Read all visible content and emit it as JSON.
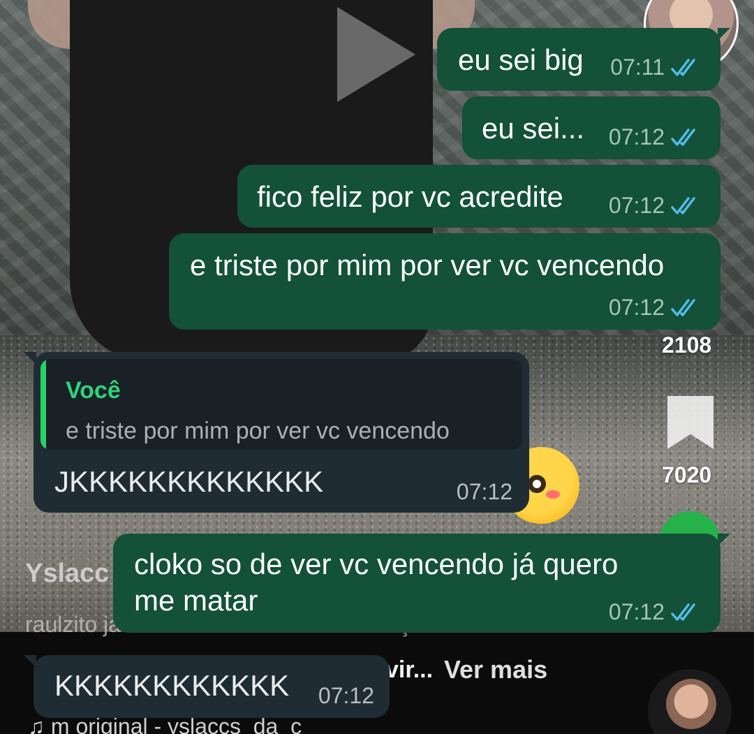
{
  "chat": {
    "messages": [
      {
        "text": "eu sei big",
        "time": "07:11",
        "status": "read"
      },
      {
        "text": "eu sei...",
        "time": "07:12",
        "status": "read"
      },
      {
        "text": "fico feliz por vc acredite",
        "time": "07:12",
        "status": "read"
      },
      {
        "text": "e triste por mim por ver vc vencendo",
        "time": "07:12",
        "status": "read"
      },
      {
        "quote_author": "Você",
        "quote_text": "e triste por mim por ver vc vencendo",
        "text": "JKKKKKKKKKKKKK",
        "time": "07:12"
      },
      {
        "text_line1": "cloko so de ver vc vencendo já quero",
        "text_line2": "me matar",
        "time": "07:12",
        "status": "read"
      },
      {
        "text": "KKKKKKKKKKKK",
        "time": "07:12"
      }
    ],
    "colors": {
      "outgoing": "#135139",
      "incoming": "#1f2c33",
      "read_ticks": "#53bdeb",
      "quote_accent": "#25d366"
    }
  },
  "video": {
    "comments_count": "2108",
    "saves_count": "7020",
    "username": "Yslacc",
    "description": "raulzito já fez 20 kills com essas chanças",
    "description_tail": "vir...",
    "more_label": "Ver mais",
    "sound": "m original - yslaccs_da_c",
    "icons": [
      "play-icon",
      "bookmark-icon",
      "share-icon",
      "music-note-icon"
    ]
  }
}
